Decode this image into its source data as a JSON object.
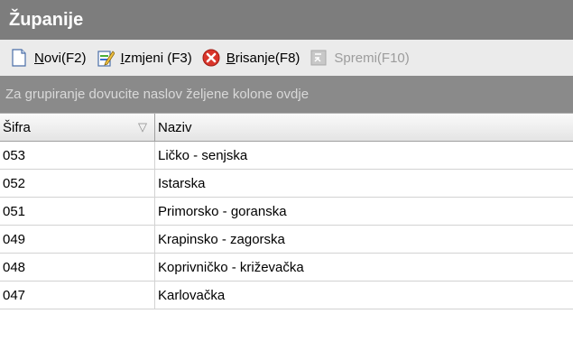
{
  "window": {
    "title": "Županije"
  },
  "toolbar": {
    "new": {
      "underline": "N",
      "rest": "ovi(F2)",
      "icon": "new-document-icon"
    },
    "edit": {
      "underline": "I",
      "rest": "zmjeni (F3)",
      "icon": "edit-document-icon"
    },
    "delete": {
      "underline": "B",
      "rest": "risanje(F8)",
      "icon": "delete-icon"
    },
    "save": {
      "label": "Spremi(F10)",
      "icon": "save-icon",
      "disabled": true
    }
  },
  "groupbar": {
    "text": "Za grupiranje dovucite naslov željene kolone ovdje"
  },
  "grid": {
    "columns": [
      {
        "label": "Šifra",
        "sorted": "descending"
      },
      {
        "label": "Naziv"
      }
    ],
    "rows": [
      {
        "code": "053",
        "name": "Ličko - senjska"
      },
      {
        "code": "052",
        "name": "Istarska"
      },
      {
        "code": "051",
        "name": "Primorsko - goranska"
      },
      {
        "code": "049",
        "name": "Krapinsko - zagorska"
      },
      {
        "code": "048",
        "name": "Koprivničko - križevačka"
      },
      {
        "code": "047",
        "name": "Karlovačka"
      }
    ]
  },
  "colors": {
    "titlebar": "#7d7d7d",
    "toolbar": "#ebebeb",
    "groupbar": "#8a8a8a",
    "delete_red": "#d9352b",
    "edit_green": "#4caf38",
    "edit_blue": "#3a6fd0"
  }
}
